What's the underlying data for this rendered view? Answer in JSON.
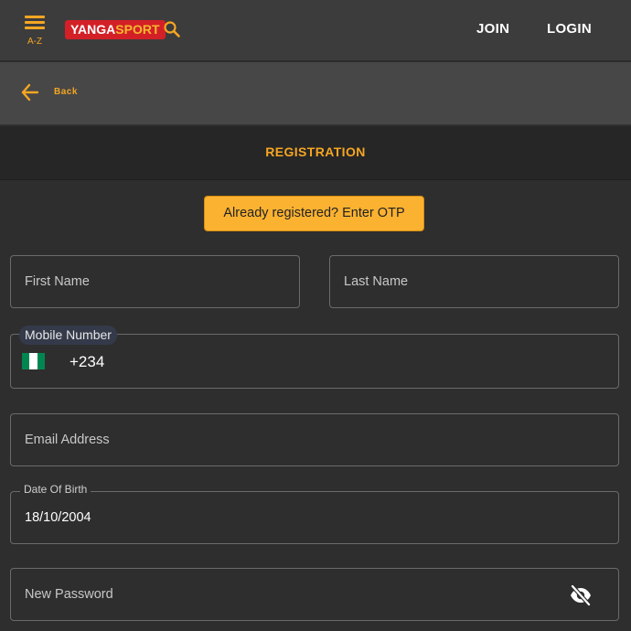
{
  "header": {
    "menu_label": "A-Z",
    "logo": {
      "part1": "YANGA",
      "part2": "SPORT"
    },
    "join_label": "JOIN",
    "login_label": "LOGIN"
  },
  "back": {
    "label": "Back"
  },
  "page": {
    "title": "REGISTRATION"
  },
  "otp_button": {
    "label": "Already registered? Enter OTP"
  },
  "form": {
    "first_name": {
      "placeholder": "First Name",
      "value": ""
    },
    "last_name": {
      "placeholder": "Last Name",
      "value": ""
    },
    "mobile": {
      "label": "Mobile Number",
      "prefix": "+234",
      "value": ""
    },
    "email": {
      "placeholder": "Email Address",
      "value": ""
    },
    "dob": {
      "label": "Date Of Birth",
      "value": "18/10/2004"
    },
    "password": {
      "placeholder": "New Password",
      "value": ""
    }
  },
  "colors": {
    "accent": "#f5a623",
    "logo_red": "#d32027",
    "otp_button": "#fbb231",
    "flag_green": "#008751"
  },
  "icons": {
    "menu": "hamburger-icon",
    "search": "search-icon",
    "back": "arrow-left-icon",
    "flag": "nigeria-flag-icon",
    "password_toggle": "eye-off-icon"
  }
}
